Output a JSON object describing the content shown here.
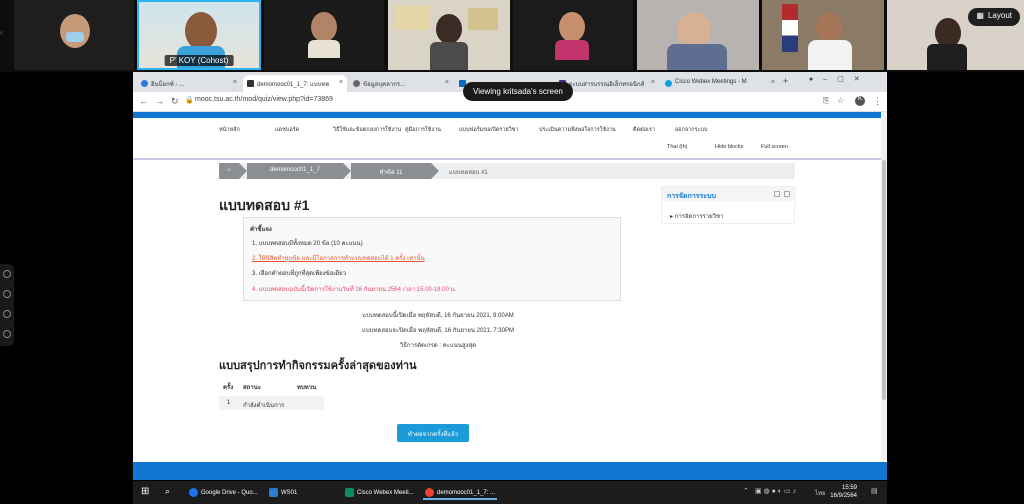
{
  "participants": [
    {
      "name": ""
    },
    {
      "name": "P' KOY  (Cohost)"
    },
    {
      "name": ""
    },
    {
      "name": ""
    },
    {
      "name": ""
    },
    {
      "name": ""
    },
    {
      "name": ""
    },
    {
      "name": ""
    }
  ],
  "layout_button": {
    "label": "Layout"
  },
  "sharing_banner": "Viewing kritsada's screen",
  "browser": {
    "tabs": [
      {
        "label": "อินบ็อกซ์ - ...",
        "active": false
      },
      {
        "label": "demomooc01_1_7: แบบทด",
        "active": true
      },
      {
        "label": "ข้อมูลบุคลากร...",
        "active": false
      },
      {
        "label": "",
        "active": false
      },
      {
        "label": "ระบบสารบรรณอิเล็กทรอนิกส์",
        "active": false
      },
      {
        "label": "Cisco Webex Meetings - M",
        "active": false
      }
    ],
    "url": "mooc.tsu.ac.th/mod/quiz/view.php?id=73869"
  },
  "moodle_nav": {
    "items": [
      "หน้าหลัก",
      "แดชบอร์ด",
      "วิธีใช้และข้อตกลงการใช้งาน",
      "คู่มือการใช้งาน",
      "แบบฟอร์มขอเปิดรายวิชา",
      "ประเมินความพึงพอใจการใช้งาน",
      "ติดต่อเรา",
      "ออกจากระบบ"
    ],
    "language": "Thai (th)",
    "hide_blocks": "Hide blocks",
    "full_screen": "Full screen"
  },
  "breadcrumb": {
    "home_icon": "home-icon",
    "course": "demomooc01_1_7",
    "section": "หัวข้อ 11",
    "current": "แบบทดสอบ #1"
  },
  "quiz": {
    "title": "แบบทดสอบ #1",
    "instructions_title": "คำชี้แจง",
    "instructions": [
      "1. แบบทดสอบมีทั้งหมด 20 ข้อ (10 คะแนน)",
      "2. ให้นิสิตทำทุกข้อ และมีโอกาสการทำแบบทดสอบได้ 1 ครั้ง เท่านั้น",
      "3. เลือกคำตอบที่ถูกที่สุดเพียงข้อเดียว",
      "4. แบบทดสอบฉบับนี้เปิดการใช้งานวันที่ 16 กันยายน 2564 เวลา 15.00-18.00 น."
    ],
    "opened": "แบบทดสอบนี้เปิดเมื่อ พฤหัสบดี, 16 กันยายน 2021, 9:00AM",
    "closes": "แบบทดสอบจะปิดเมื่อ พฤหัสบดี, 16 กันยายน 2021, 7:30PM",
    "grading": "วิธีการตัดเกรด : คะแนนสูงสุด",
    "summary_title": "แบบสรุปการทำกิจกรรมครั้งล่าสุดของท่าน",
    "summary_headers": [
      "ครั้ง",
      "สถานะ",
      "ทบทวน"
    ],
    "summary_rows": [
      {
        "attempt": "1",
        "status": "กำลังดำเนินการ"
      }
    ],
    "continue_button": "ทำต่อจากครั้งที่แล้ว"
  },
  "sidebar_block": {
    "title": "การจัดการระบบ",
    "item": "การจัดการรายวิชา"
  },
  "taskbar": {
    "items": [
      {
        "label": "Google Drive - Quo...",
        "color": "#1a73e8"
      },
      {
        "label": "WS01",
        "color": "#2b7cd3"
      },
      {
        "label": "Cisco Webex Meeti...",
        "color": "#0a8f5c"
      },
      {
        "label": "demomooc01_1_7: ...",
        "color": "#e94235"
      }
    ],
    "lang": "ไทย",
    "time": "15:59",
    "date": "16/9/2564"
  },
  "colors": {
    "moodle_blue": "#1177d1",
    "button_blue": "#1b9bd7"
  }
}
